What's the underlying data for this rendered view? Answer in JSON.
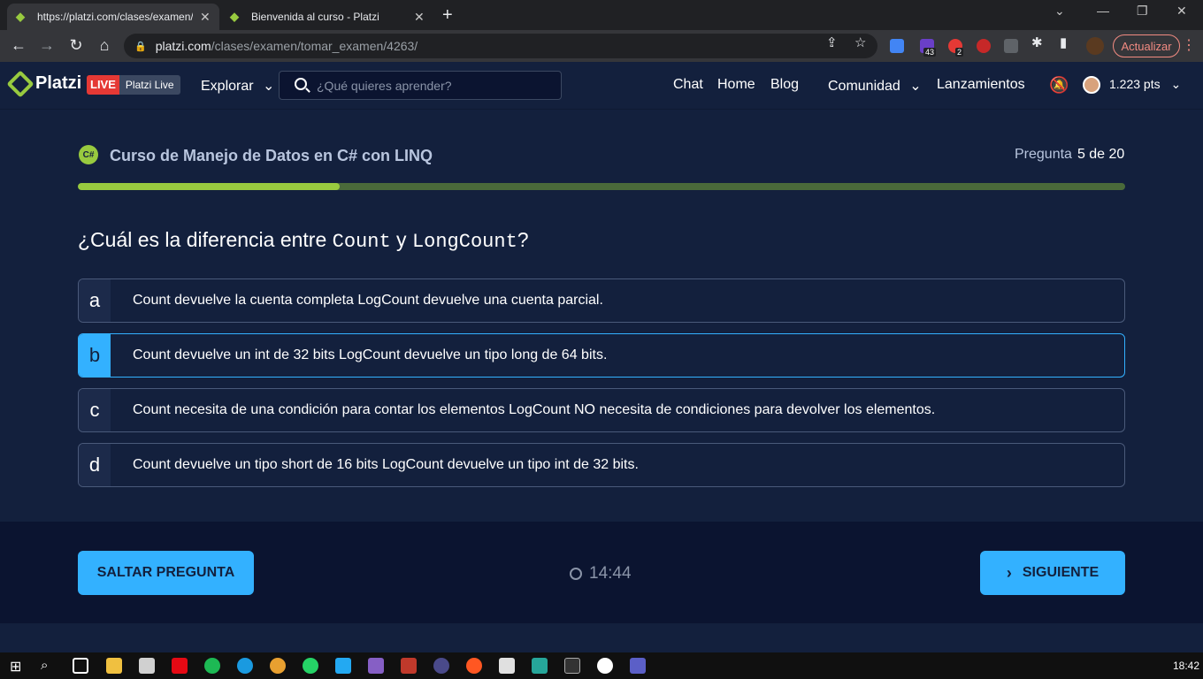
{
  "browser": {
    "tabs": [
      {
        "title": "https://platzi.com/clases/examen/",
        "active": true
      },
      {
        "title": "Bienvenida al curso - Platzi",
        "active": false
      }
    ],
    "url_host": "platzi.com",
    "url_path": "/clases/examen/tomar_examen/4263/",
    "update_label": "Actualizar",
    "ext_badges": [
      "43",
      "2"
    ]
  },
  "header": {
    "logo": "Platzi",
    "live_badge": "LIVE",
    "live_label": "Platzi Live",
    "explore": "Explorar",
    "search_placeholder": "¿Qué quieres aprender?",
    "nav": [
      "Chat",
      "Home",
      "Blog",
      "Comunidad",
      "Lanzamientos"
    ],
    "points": "1.223 pts"
  },
  "exam": {
    "course_icon_text": "C#",
    "course_title": "Curso de Manejo de Datos en C# con LINQ",
    "question_label": "Pregunta",
    "question_progress": "5 de 20",
    "progress_fraction": 0.25,
    "question_prefix": "¿Cuál es la diferencia entre ",
    "question_code_1": "Count",
    "question_middle": " y ",
    "question_code_2": "LongCount",
    "question_suffix": "?",
    "options": [
      {
        "letter": "a",
        "text": "Count devuelve la cuenta completa LogCount devuelve una cuenta parcial."
      },
      {
        "letter": "b",
        "text": "Count devuelve un int de 32 bits LogCount devuelve un tipo long de 64 bits."
      },
      {
        "letter": "c",
        "text": "Count necesita de una condición para contar los elementos LogCount NO necesita de condiciones para devolver los elementos."
      },
      {
        "letter": "d",
        "text": "Count devuelve un tipo short de 16 bits LogCount devuelve un tipo int de 32 bits."
      }
    ],
    "selected_option": "b"
  },
  "footer": {
    "skip_label": "SALTAR PREGUNTA",
    "timer": "14:44",
    "next_label": "SIGUIENTE"
  },
  "taskbar": {
    "clock": "18:42"
  },
  "colors": {
    "accent_green": "#98ca3f",
    "accent_blue": "#33b1ff",
    "background": "#13203d"
  }
}
